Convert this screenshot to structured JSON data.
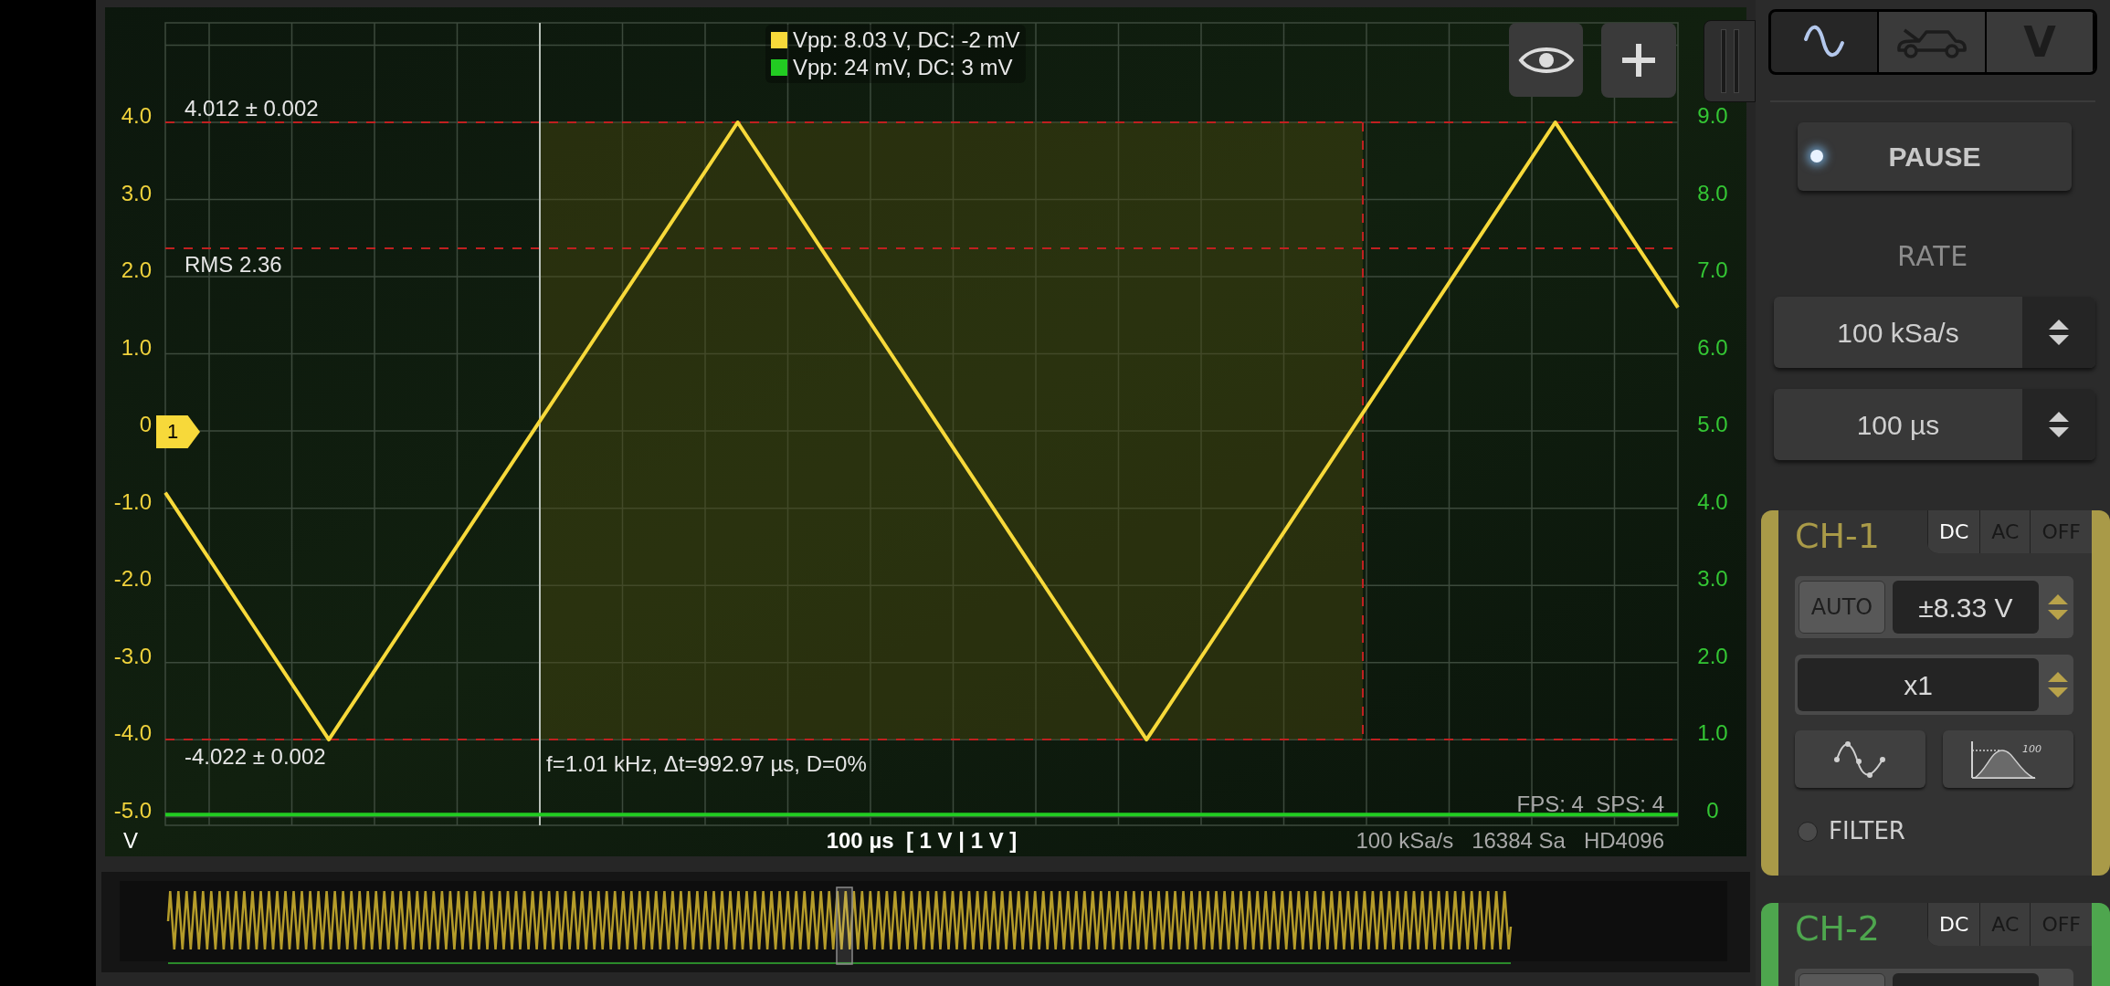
{
  "scope": {
    "legend": [
      {
        "text": "Vpp: 8.03 V, DC: -2 mV",
        "color": "#f7d93a"
      },
      {
        "text": "Vpp: 24 mV, DC: 3 mV",
        "color": "#22cc22"
      }
    ],
    "channel_marker": "1",
    "right_axis_ticks": [
      "9.0",
      "8.0",
      "7.0",
      "6.0",
      "5.0",
      "4.0",
      "3.0",
      "2.0",
      "1.0",
      "0"
    ],
    "measurements": [
      {
        "kind": "upper",
        "text": "4.012 ± 0.002"
      },
      {
        "kind": "rms",
        "text": "RMS 2.36"
      },
      {
        "kind": "lower",
        "text": "-4.022 ± 0.002"
      },
      {
        "kind": "cursor",
        "text": "f=1.01 kHz, Δt=992.97 µs, D=0%"
      }
    ],
    "fps": "FPS: 4  SPS: 4",
    "timebase": "100 µs  [ 1 V | 1 V ]",
    "acquisition": "100 kSa/s   16384 Sa   HD4096",
    "chart_data": {
      "type": "line",
      "grid": true,
      "ylabel": "V",
      "categories": [
        null,
        null,
        null,
        null,
        null,
        null,
        null,
        null,
        null,
        null,
        null,
        null,
        null,
        null,
        null,
        null,
        null,
        null,
        null,
        null,
        null,
        null,
        null,
        null,
        null,
        null,
        null,
        null,
        null,
        null,
        null,
        null,
        null,
        null,
        null,
        null,
        null,
        null
      ],
      "ylim": [
        -5.11,
        5.29
      ],
      "yticks": [
        {
          "value": 4,
          "label": "4.0"
        },
        {
          "value": 3,
          "label": "3.0"
        },
        {
          "value": 2,
          "label": "2.0"
        },
        {
          "value": 1,
          "label": "1.0"
        },
        {
          "value": 0,
          "label": "0"
        },
        {
          "value": -1,
          "label": "-1.0"
        },
        {
          "value": -2,
          "label": "-2.0"
        },
        {
          "value": -3,
          "label": "-3.0"
        },
        {
          "value": -4,
          "label": "-4.0"
        },
        {
          "value": -5,
          "label": "-5.0"
        }
      ],
      "series": [
        {
          "color": "#f7d93a",
          "values": [
            -0.8,
            -1.6,
            -2.4,
            -3.2,
            -4.0,
            -3.2,
            -2.4,
            -1.6,
            -0.8,
            0.0,
            0.8,
            1.6,
            2.4,
            3.2,
            4.0,
            3.2,
            2.4,
            1.6,
            0.8,
            0.0,
            -0.8,
            -1.6,
            -2.4,
            -3.2,
            -4.0,
            -3.2,
            -2.4,
            -1.6,
            -0.8,
            0.0,
            0.8,
            1.6,
            2.4,
            3.2,
            4.0,
            3.2,
            2.4,
            1.6
          ]
        },
        {
          "color": "#22cc22",
          "values": [
            -4.97,
            -4.97,
            -4.97,
            -4.97,
            -4.97,
            -4.97,
            -4.97,
            -4.97,
            -4.97,
            -4.97,
            -4.97,
            -4.97,
            -4.97,
            -4.97,
            -4.97,
            -4.97,
            -4.97,
            -4.97,
            -4.97,
            -4.97,
            -4.97,
            -4.97,
            -4.97,
            -4.97,
            -4.97,
            -4.97,
            -4.97,
            -4.97,
            -4.97,
            -4.97,
            -4.97,
            -4.97,
            -4.97,
            -4.97,
            -4.97,
            -4.97,
            -4.97,
            -4.97
          ]
        }
      ]
    }
  },
  "mode_tabs": [
    {
      "kind": "sine",
      "selected": true
    },
    {
      "kind": "car",
      "selected": false
    },
    {
      "kind": "text",
      "label": "V",
      "selected": false
    }
  ],
  "pause_button": {
    "label": "PAUSE",
    "led_on": true
  },
  "rate": {
    "title": "RATE",
    "sample_rate": "100 kSa/s",
    "timebase": "100 µs"
  },
  "channels": [
    {
      "name": "CH-1",
      "color": "#a99a48",
      "coupling": [
        {
          "label": "DC",
          "selected": true
        },
        {
          "label": "AC",
          "selected": false
        },
        {
          "label": "OFF",
          "selected": false
        }
      ],
      "auto_label": "AUTO",
      "range": "±8.33 V",
      "probe": "x1",
      "filter_icon_label": "100",
      "filter": {
        "label": "FILTER",
        "on": false
      }
    },
    {
      "name": "CH-2",
      "color": "#4ea64e",
      "coupling": [
        {
          "label": "DC",
          "selected": true
        },
        {
          "label": "AC",
          "selected": false
        },
        {
          "label": "OFF",
          "selected": false
        }
      ]
    }
  ]
}
